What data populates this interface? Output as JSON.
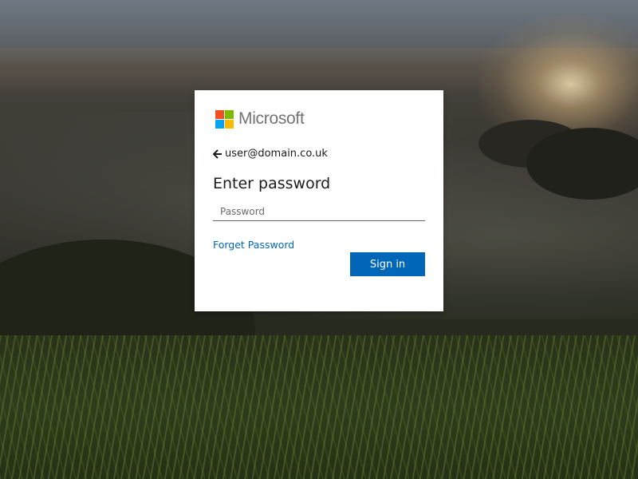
{
  "brand": {
    "name": "Microsoft",
    "logo_colors": [
      "#f25022",
      "#7fba00",
      "#00a4ef",
      "#ffb900"
    ]
  },
  "identity": {
    "back_icon": "arrow-left-icon",
    "email": "user@domain.co.uk"
  },
  "form": {
    "title": "Enter password",
    "password_placeholder": "Password",
    "password_value": "",
    "forgot_link": "Forget Password",
    "submit_label": "Sign in"
  },
  "colors": {
    "accent": "#0067b8",
    "text": "#1b1b1b",
    "card_bg": "#ffffff"
  }
}
